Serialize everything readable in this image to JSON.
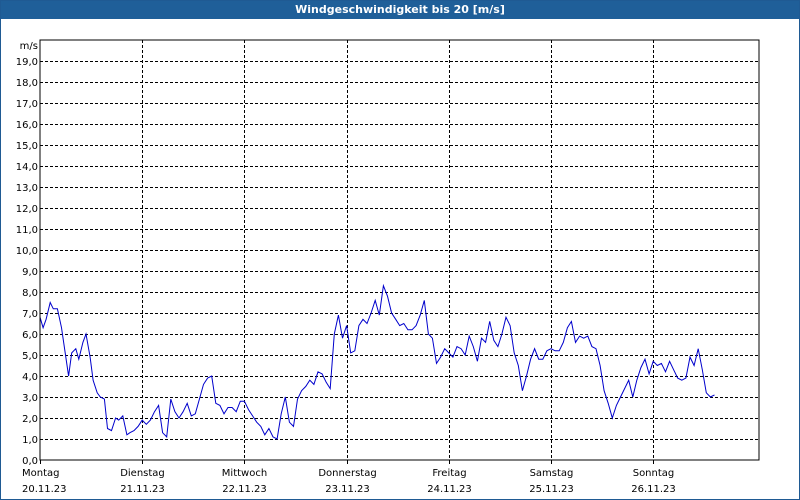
{
  "window": {
    "title": "Windgeschwindigkeit bis 20 [m/s]"
  },
  "colors": {
    "titlebar": "#1f5f99",
    "line": "#0000cc",
    "grid": "#000000"
  },
  "chart_data": {
    "type": "line",
    "title": "Windgeschwindigkeit bis 20 [m/s]",
    "ylabel": "m/s",
    "xlabel": "",
    "ylim": [
      0,
      20
    ],
    "yticks": [
      "0,0",
      "1,0",
      "2,0",
      "3,0",
      "4,0",
      "5,0",
      "6,0",
      "7,0",
      "8,0",
      "9,0",
      "10,0",
      "11,0",
      "12,0",
      "13,0",
      "14,0",
      "15,0",
      "16,0",
      "17,0",
      "18,0",
      "19,0"
    ],
    "xticks": [
      {
        "day": "Montag",
        "date": "20.11.23"
      },
      {
        "day": "Dienstag",
        "date": "21.11.23"
      },
      {
        "day": "Mittwoch",
        "date": "22.11.23"
      },
      {
        "day": "Donnerstag",
        "date": "23.11.23"
      },
      {
        "day": "Freitag",
        "date": "24.11.23"
      },
      {
        "day": "Samstag",
        "date": "25.11.23"
      },
      {
        "day": "Sonntag",
        "date": "26.11.23"
      }
    ],
    "grid": "dashed",
    "series": [
      {
        "x_unit": "days since Montag 20.11.23",
        "points": [
          [
            0.0,
            6.8
          ],
          [
            0.03,
            6.3
          ],
          [
            0.06,
            6.7
          ],
          [
            0.1,
            7.5
          ],
          [
            0.13,
            7.2
          ],
          [
            0.17,
            7.2
          ],
          [
            0.21,
            6.3
          ],
          [
            0.25,
            5.0
          ],
          [
            0.28,
            4.0
          ],
          [
            0.31,
            5.1
          ],
          [
            0.35,
            5.3
          ],
          [
            0.38,
            4.8
          ],
          [
            0.42,
            5.6
          ],
          [
            0.45,
            6.0
          ],
          [
            0.49,
            4.9
          ],
          [
            0.52,
            3.8
          ],
          [
            0.56,
            3.2
          ],
          [
            0.59,
            3.0
          ],
          [
            0.63,
            2.9
          ],
          [
            0.66,
            1.5
          ],
          [
            0.7,
            1.4
          ],
          [
            0.74,
            2.0
          ],
          [
            0.77,
            1.9
          ],
          [
            0.81,
            2.1
          ],
          [
            0.85,
            1.2
          ],
          [
            0.88,
            1.3
          ],
          [
            0.92,
            1.4
          ],
          [
            0.96,
            1.6
          ],
          [
            1.0,
            1.9
          ],
          [
            1.04,
            1.7
          ],
          [
            1.08,
            1.9
          ],
          [
            1.12,
            2.3
          ],
          [
            1.16,
            2.6
          ],
          [
            1.2,
            1.3
          ],
          [
            1.24,
            1.1
          ],
          [
            1.28,
            2.9
          ],
          [
            1.32,
            2.3
          ],
          [
            1.36,
            2.0
          ],
          [
            1.4,
            2.3
          ],
          [
            1.44,
            2.7
          ],
          [
            1.48,
            2.1
          ],
          [
            1.52,
            2.2
          ],
          [
            1.56,
            2.9
          ],
          [
            1.6,
            3.6
          ],
          [
            1.64,
            3.9
          ],
          [
            1.68,
            4.0
          ],
          [
            1.72,
            2.7
          ],
          [
            1.76,
            2.6
          ],
          [
            1.8,
            2.2
          ],
          [
            1.84,
            2.5
          ],
          [
            1.88,
            2.5
          ],
          [
            1.92,
            2.3
          ],
          [
            1.96,
            2.8
          ],
          [
            2.0,
            2.8
          ],
          [
            2.04,
            2.4
          ],
          [
            2.08,
            2.1
          ],
          [
            2.12,
            1.8
          ],
          [
            2.16,
            1.6
          ],
          [
            2.2,
            1.2
          ],
          [
            2.24,
            1.5
          ],
          [
            2.28,
            1.1
          ],
          [
            2.32,
            1.0
          ],
          [
            2.36,
            2.2
          ],
          [
            2.4,
            3.0
          ],
          [
            2.44,
            1.8
          ],
          [
            2.48,
            1.6
          ],
          [
            2.52,
            2.9
          ],
          [
            2.56,
            3.3
          ],
          [
            2.6,
            3.5
          ],
          [
            2.64,
            3.8
          ],
          [
            2.68,
            3.6
          ],
          [
            2.72,
            4.2
          ],
          [
            2.76,
            4.1
          ],
          [
            2.8,
            3.7
          ],
          [
            2.84,
            3.4
          ],
          [
            2.88,
            6.0
          ],
          [
            2.92,
            6.9
          ],
          [
            2.96,
            5.8
          ],
          [
            3.0,
            6.4
          ],
          [
            3.04,
            5.1
          ],
          [
            3.08,
            5.2
          ],
          [
            3.12,
            6.4
          ],
          [
            3.16,
            6.7
          ],
          [
            3.2,
            6.5
          ],
          [
            3.24,
            7.0
          ],
          [
            3.28,
            7.6
          ],
          [
            3.32,
            6.9
          ],
          [
            3.36,
            8.3
          ],
          [
            3.4,
            7.8
          ],
          [
            3.44,
            7.0
          ],
          [
            3.48,
            6.7
          ],
          [
            3.52,
            6.4
          ],
          [
            3.56,
            6.5
          ],
          [
            3.6,
            6.2
          ],
          [
            3.64,
            6.2
          ],
          [
            3.68,
            6.4
          ],
          [
            3.72,
            6.9
          ],
          [
            3.76,
            7.6
          ],
          [
            3.8,
            6.0
          ],
          [
            3.84,
            5.8
          ],
          [
            3.88,
            4.6
          ],
          [
            3.92,
            4.9
          ],
          [
            3.96,
            5.3
          ],
          [
            4.0,
            5.1
          ],
          [
            4.04,
            4.9
          ],
          [
            4.08,
            5.4
          ],
          [
            4.12,
            5.3
          ],
          [
            4.16,
            5.0
          ],
          [
            4.2,
            5.9
          ],
          [
            4.24,
            5.4
          ],
          [
            4.28,
            4.7
          ],
          [
            4.32,
            5.8
          ],
          [
            4.36,
            5.6
          ],
          [
            4.4,
            6.6
          ],
          [
            4.44,
            5.7
          ],
          [
            4.48,
            5.4
          ],
          [
            4.52,
            6.0
          ],
          [
            4.56,
            6.8
          ],
          [
            4.6,
            6.4
          ],
          [
            4.64,
            5.1
          ],
          [
            4.68,
            4.5
          ],
          [
            4.72,
            3.3
          ],
          [
            4.76,
            4.0
          ],
          [
            4.8,
            4.8
          ],
          [
            4.84,
            5.3
          ],
          [
            4.88,
            4.8
          ],
          [
            4.92,
            4.8
          ],
          [
            4.96,
            5.2
          ],
          [
            5.0,
            5.3
          ],
          [
            5.04,
            5.2
          ],
          [
            5.08,
            5.2
          ],
          [
            5.12,
            5.6
          ],
          [
            5.16,
            6.3
          ],
          [
            5.2,
            6.6
          ],
          [
            5.24,
            5.6
          ],
          [
            5.28,
            5.9
          ],
          [
            5.32,
            5.8
          ],
          [
            5.36,
            5.9
          ],
          [
            5.4,
            5.4
          ],
          [
            5.44,
            5.3
          ],
          [
            5.48,
            4.5
          ],
          [
            5.52,
            3.3
          ],
          [
            5.56,
            2.7
          ],
          [
            5.6,
            2.0
          ],
          [
            5.64,
            2.6
          ],
          [
            5.68,
            3.0
          ],
          [
            5.72,
            3.4
          ],
          [
            5.76,
            3.8
          ],
          [
            5.8,
            3.0
          ],
          [
            5.84,
            3.8
          ],
          [
            5.88,
            4.4
          ],
          [
            5.92,
            4.8
          ],
          [
            5.96,
            4.1
          ],
          [
            6.0,
            4.7
          ],
          [
            6.04,
            4.5
          ],
          [
            6.08,
            4.6
          ],
          [
            6.12,
            4.2
          ],
          [
            6.16,
            4.7
          ],
          [
            6.2,
            4.3
          ],
          [
            6.24,
            3.9
          ],
          [
            6.28,
            3.8
          ],
          [
            6.32,
            3.9
          ],
          [
            6.36,
            4.9
          ],
          [
            6.4,
            4.5
          ],
          [
            6.44,
            5.3
          ],
          [
            6.48,
            4.3
          ],
          [
            6.52,
            3.2
          ],
          [
            6.56,
            3.0
          ],
          [
            6.6,
            3.1
          ]
        ]
      }
    ]
  }
}
